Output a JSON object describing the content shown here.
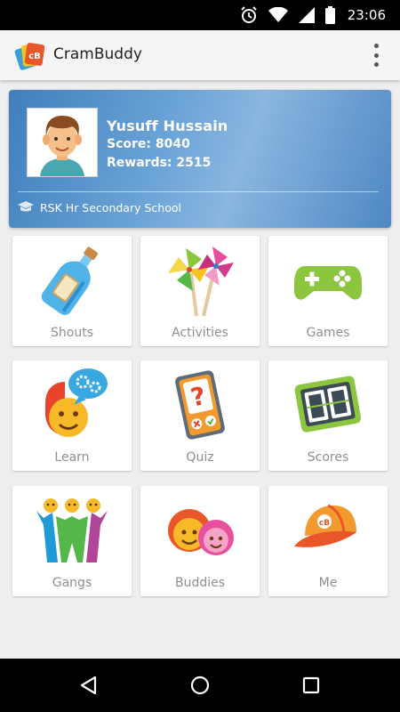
{
  "status_bar": {
    "time": "23:06",
    "icons": [
      "alarm-icon",
      "wifi-icon",
      "signal-icon",
      "battery-icon"
    ]
  },
  "app_bar": {
    "title": "CramBuddy",
    "logo_icon": "crambuddy-logo-icon",
    "overflow_icon": "more-vert-icon"
  },
  "profile": {
    "name": "Yusuff Hussain",
    "score": "Score: 8040",
    "rewards": "Rewards: 2515",
    "school": "RSK Hr Secondary School",
    "school_icon": "graduation-cap-icon"
  },
  "tiles": [
    {
      "label": "Shouts",
      "icon": "message-bottle-icon"
    },
    {
      "label": "Activities",
      "icon": "pinwheel-icon"
    },
    {
      "label": "Games",
      "icon": "gamepad-icon"
    },
    {
      "label": "Learn",
      "icon": "learn-head-icon"
    },
    {
      "label": "Quiz",
      "icon": "quiz-device-icon"
    },
    {
      "label": "Scores",
      "icon": "scoreboard-icon"
    },
    {
      "label": "Gangs",
      "icon": "gang-people-icon"
    },
    {
      "label": "Buddies",
      "icon": "buddies-faces-icon"
    },
    {
      "label": "Me",
      "icon": "cap-icon"
    }
  ],
  "nav_bar": {
    "icons": [
      "back-icon",
      "home-icon",
      "recents-icon"
    ]
  },
  "colors": {
    "status_bar": "#000000",
    "app_bar": "#f5f5f5",
    "profile_card": "#5a94cc",
    "tile_label": "#8f8f8f",
    "background": "#eeeeee"
  }
}
